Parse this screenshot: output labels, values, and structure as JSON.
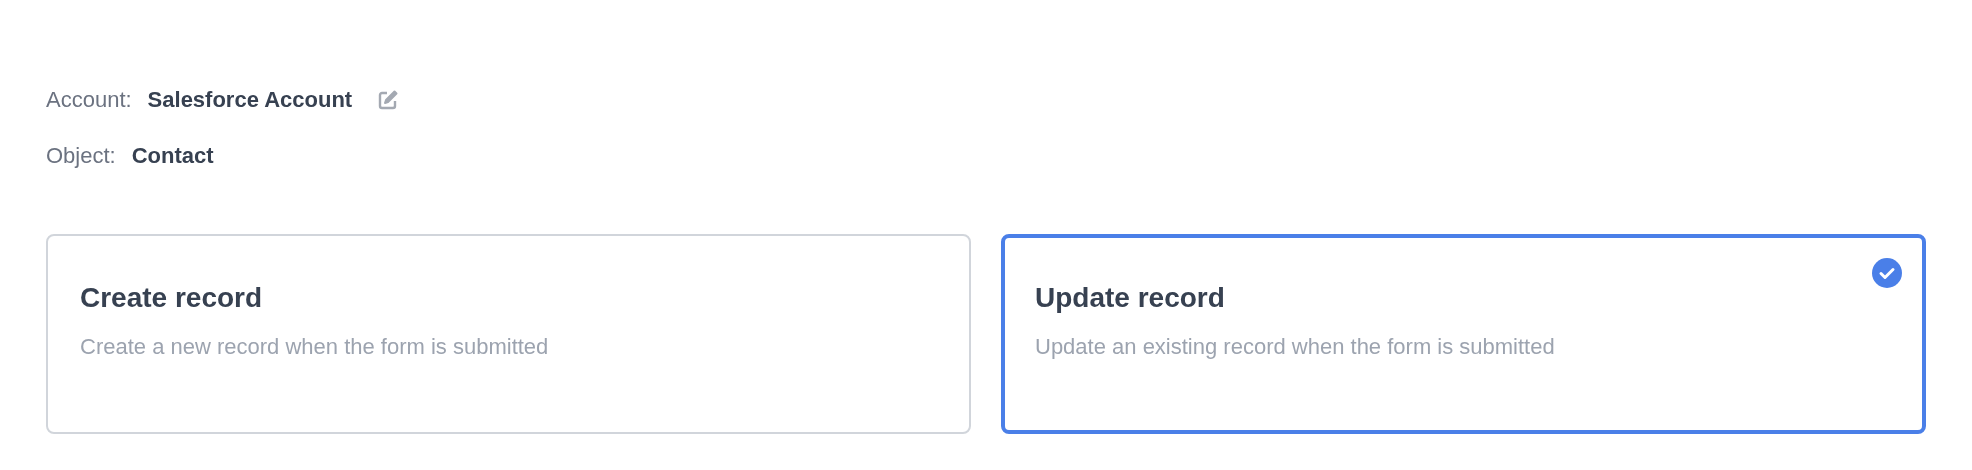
{
  "details": [
    {
      "label": "Account:",
      "value": "Salesforce Account",
      "editable": true
    },
    {
      "label": "Object:",
      "value": "Contact",
      "editable": false
    }
  ],
  "options": [
    {
      "title": "Create record",
      "description": "Create a new record when the form is submitted",
      "selected": false
    },
    {
      "title": "Update record",
      "description": "Update an existing record when the form is submitted",
      "selected": true
    }
  ]
}
